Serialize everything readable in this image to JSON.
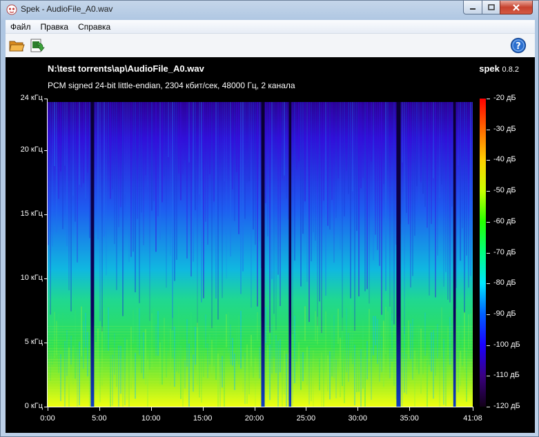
{
  "window": {
    "title": "Spek - AudioFile_A0.wav",
    "app_icon": "spek-logo-icon"
  },
  "menu": [
    "Файл",
    "Правка",
    "Справка"
  ],
  "toolbar": {
    "open_icon": "folder-open-icon",
    "save_icon": "save-image-icon",
    "help_icon": "help-icon"
  },
  "header": {
    "file_path": "N:\\test torrents\\ap\\AudioFile_A0.wav",
    "file_info": "PCM signed 24-bit little-endian, 2304 кбит/сек, 48000 Гц, 2 канала",
    "brand_name": "spek",
    "brand_version": "0.8.2"
  },
  "spectrogram": {
    "y_labels": [
      "24 кГц",
      "20 кГц",
      "15 кГц",
      "10 кГц",
      "5 кГц",
      "0 кГц"
    ],
    "y_values": [
      24,
      20,
      15,
      10,
      5,
      0
    ],
    "x_labels": [
      "0:00",
      "5:00",
      "10:00",
      "15:00",
      "20:00",
      "25:00",
      "30:00",
      "35:00",
      "41:08"
    ],
    "x_values": [
      0,
      300,
      600,
      900,
      1200,
      1500,
      1800,
      2100,
      2468
    ],
    "db_labels": [
      "-20 дБ",
      "-30 дБ",
      "-40 дБ",
      "-50 дБ",
      "-60 дБ",
      "-70 дБ",
      "-80 дБ",
      "-90 дБ",
      "-100 дБ",
      "-110 дБ",
      "-120 дБ"
    ],
    "db_values": [
      -20,
      -30,
      -40,
      -50,
      -60,
      -70,
      -80,
      -90,
      -100,
      -110,
      -120
    ],
    "duration_seconds": 2468,
    "max_freq_khz": 24,
    "gaps_seconds": [
      [
        250,
        270
      ],
      [
        1240,
        1260
      ],
      [
        1400,
        1415
      ],
      [
        2025,
        2050
      ],
      [
        2355,
        2370
      ]
    ]
  }
}
